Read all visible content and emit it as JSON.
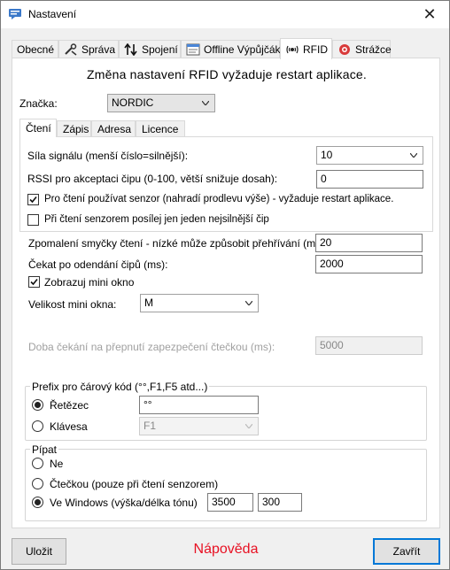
{
  "window": {
    "title": "Nastavení",
    "close_glyph": "✕"
  },
  "tabs": [
    {
      "label": "Obecné",
      "icon": ""
    },
    {
      "label": "Správa",
      "icon": "tools-icon"
    },
    {
      "label": "Spojení",
      "icon": "arrows-updown-icon"
    },
    {
      "label": "Offline Výpůjčák",
      "icon": "notepad-icon"
    },
    {
      "label": "RFID",
      "icon": "rfid-tag-icon"
    },
    {
      "label": "Strážce",
      "icon": "shield-icon"
    }
  ],
  "active_tab": "RFID",
  "rfid": {
    "restart_warning": "Změna nastavení RFID vyžaduje restart aplikace.",
    "brand_label": "Značka:",
    "brand_value": "NORDIC"
  },
  "subtabs": [
    "Čtení",
    "Zápis",
    "Adresa",
    "Licence"
  ],
  "reading": {
    "signal_label": "Síla signálu (menší číslo=silnější):",
    "signal_value": "10",
    "rssi_label": "RSSI pro akceptaci čipu (0-100, větší snižuje dosah):",
    "rssi_value": "0",
    "sensor_check_label": "Pro čtení používat senzor (nahradí prodlevu výše) - vyžaduje restart aplikace.",
    "sensor_checked": true,
    "single_chip_label": "Při čtení senzorem posílej jen jeden nejsilnější čip",
    "single_chip_checked": false
  },
  "loop": {
    "slowdown_label": "Zpomalení smyčky čtení - nízké může způsobit přehřívání (ms):",
    "slowdown_value": "20",
    "wait_label": "Čekat po odendání čipů (ms):",
    "wait_value": "2000",
    "mini_window_label": "Zobrazuj mini okno",
    "mini_window_checked": true,
    "mini_size_label": "Velikost mini okna:",
    "mini_size_value": "M",
    "reader_wait_label": "Doba čekání na přepnutí zapezpečení čtečkou (ms):",
    "reader_wait_value": "5000"
  },
  "prefix": {
    "title": "Prefix pro čárový kód (°°,F1,F5 atd...)",
    "string_label": "Řetězec",
    "string_value": "°°",
    "key_label": "Klávesa",
    "key_value": "F1"
  },
  "beep": {
    "title": "Pípat",
    "no_label": "Ne",
    "reader_label": "Čtečkou (pouze při čtení senzorem)",
    "windows_label": "Ve Windows (výška/délka tónu)",
    "pitch_value": "3500",
    "length_value": "300"
  },
  "footer": {
    "save_label": "Uložit",
    "help_label": "Nápověda",
    "close_label": "Zavřít"
  },
  "colors": {
    "help_text": "#e81123",
    "focus_border": "#0078d7"
  }
}
